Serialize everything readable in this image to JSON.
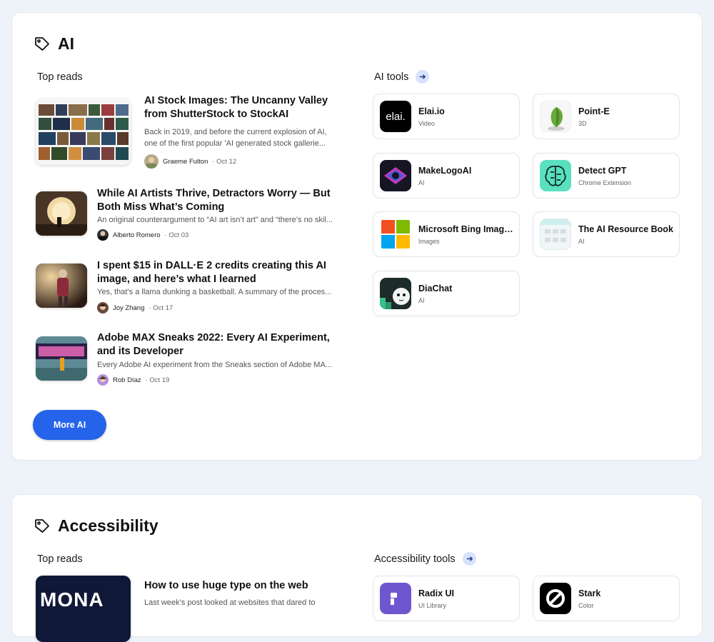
{
  "ai_section": {
    "title": "AI",
    "top_reads_label": "Top reads",
    "tools_label": "AI tools",
    "more_button": "More AI",
    "articles": [
      {
        "title_line1": "AI Stock Images: The Uncanny Valley",
        "title_line2": "from ShutterStock to StockAI",
        "excerpt_line1": "Back in 2019, and before the current explosion of AI,",
        "excerpt_line2": "one of the first popular 'AI generated stock gallerie...",
        "author": "Graeme Fulton",
        "date": "· Oct 12"
      },
      {
        "title_line1": "While AI Artists Thrive, Detractors Worry — But",
        "title_line2": "Both Miss What’s Coming",
        "excerpt_line1": "An original counterargument to “AI art isn’t art” and “there’s no skil...",
        "author": "Alberto Romero",
        "date": "· Oct 03"
      },
      {
        "title_line1": "I spent $15 in DALL·E 2 credits creating this AI",
        "title_line2": "image, and here’s what I learned",
        "excerpt_line1": "Yes, that’s a llama dunking a basketball. A summary of the proces...",
        "author": "Joy Zhang",
        "date": "· Oct 17"
      },
      {
        "title_line1": "Adobe MAX Sneaks 2022: Every AI Experiment,",
        "title_line2": "and its Developer",
        "excerpt_line1": "Every Adobe AI experiment from the Sneaks section of Adobe MA...",
        "author": "Rob Díaz",
        "date": "· Oct 19"
      }
    ],
    "tools": [
      {
        "name": "Elai.io",
        "category": "Video",
        "logo_text": "elai."
      },
      {
        "name": "Point-E",
        "category": "3D"
      },
      {
        "name": "MakeLogoAI",
        "category": "AI"
      },
      {
        "name": "Detect GPT",
        "category": "Chrome Extension"
      },
      {
        "name": "Microsoft Bing Image Creator",
        "category": "Images"
      },
      {
        "name": "The AI Resource Book",
        "category": "AI"
      },
      {
        "name": "DiaChat",
        "category": "AI"
      }
    ]
  },
  "accessibility_section": {
    "title": "Accessibility",
    "top_reads_label": "Top reads",
    "tools_label": "Accessibility tools",
    "articles": [
      {
        "title_line1": "How to use huge type on the web",
        "excerpt_line1": "Last week’s post looked at websites that dared to",
        "thumb_text": "MONA"
      }
    ],
    "tools": [
      {
        "name": "Radix UI",
        "category": "UI Library"
      },
      {
        "name": "Stark",
        "category": "Color"
      }
    ]
  },
  "colors": {
    "accent": "#2563eb",
    "arrow_bg": "#d7e3fb",
    "page_bg": "#eef2f9"
  }
}
